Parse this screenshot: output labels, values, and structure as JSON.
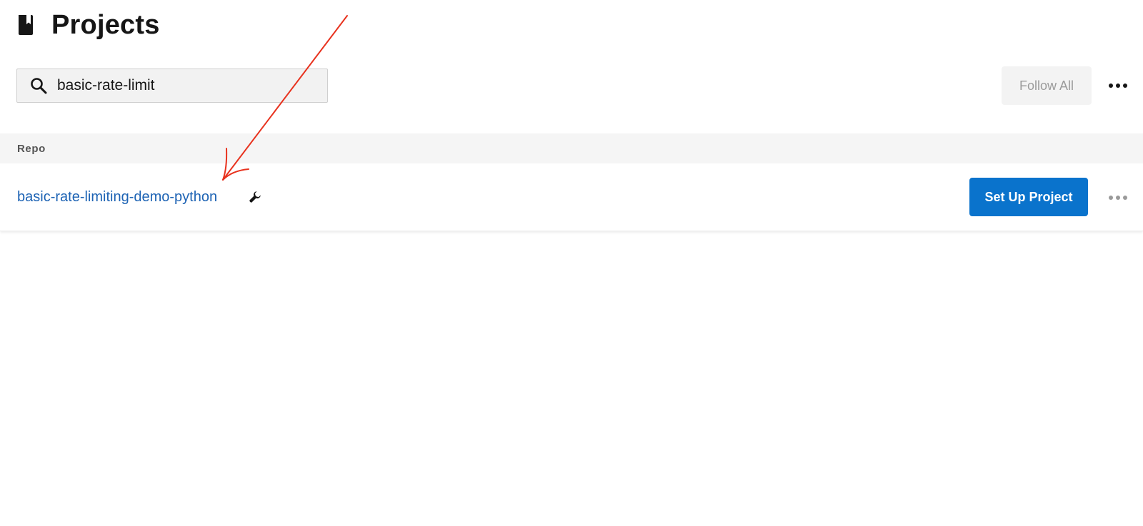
{
  "header": {
    "icon": "book-icon",
    "title": "Projects"
  },
  "search": {
    "icon": "search-icon",
    "value": "basic-rate-limit"
  },
  "toolbar": {
    "follow_all_label": "Follow All",
    "more_icon": "more-horizontal-icon"
  },
  "table": {
    "column_header": "Repo",
    "rows": [
      {
        "name": "basic-rate-limiting-demo-python",
        "badge_icon": "wrench-icon",
        "action_label": "Set Up Project",
        "more_icon": "more-horizontal-icon"
      }
    ]
  },
  "colors": {
    "link": "#1d63b4",
    "primary_button": "#0a73cc",
    "annotation_arrow": "#e8321e"
  }
}
